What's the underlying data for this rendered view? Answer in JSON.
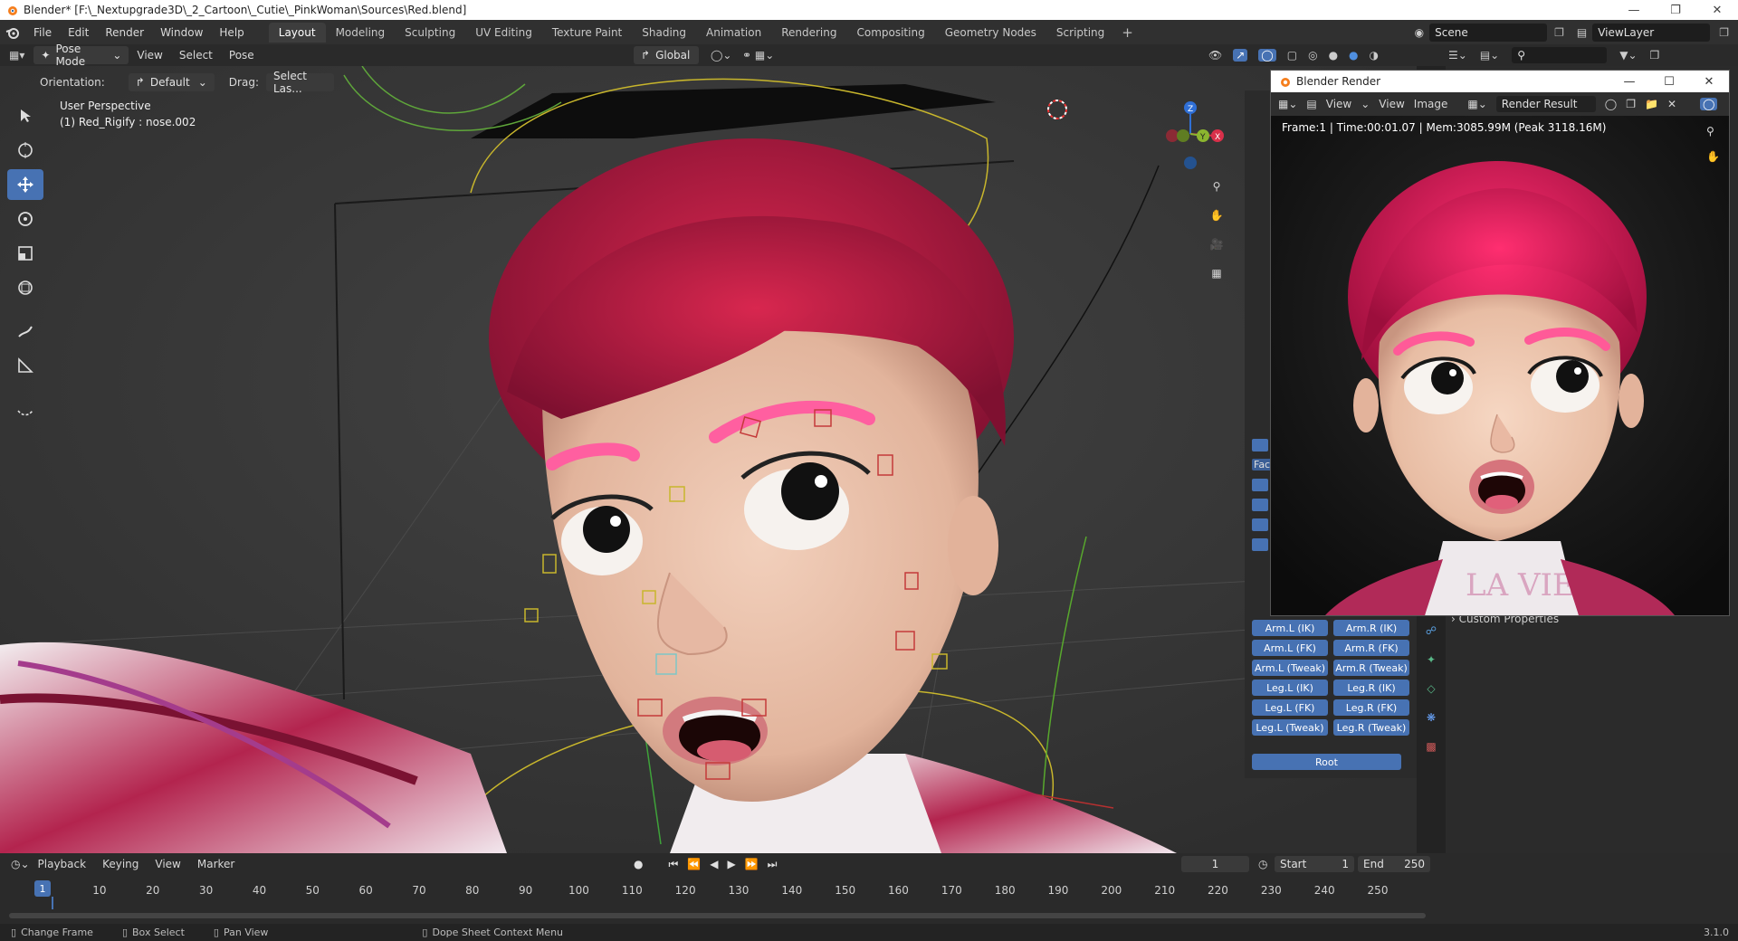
{
  "window": {
    "title": "Blender* [F:\\_Nextupgrade3D\\_2_Cartoon\\_Cutie\\_PinkWoman\\Sources\\Red.blend]"
  },
  "menu": {
    "items": [
      "File",
      "Edit",
      "Render",
      "Window",
      "Help"
    ],
    "workspaces": [
      "Layout",
      "Modeling",
      "Sculpting",
      "UV Editing",
      "Texture Paint",
      "Shading",
      "Animation",
      "Rendering",
      "Compositing",
      "Geometry Nodes",
      "Scripting"
    ],
    "active_workspace": "Layout",
    "scene": "Scene",
    "view_layer": "ViewLayer"
  },
  "viewport_header": {
    "mode": "Pose Mode",
    "menus": [
      "View",
      "Select",
      "Pose"
    ],
    "transform_orientation": "Global"
  },
  "tool_options": {
    "orientation_label": "Orientation:",
    "orientation_value": "Default",
    "drag_label": "Drag:",
    "drag_value": "Select Las..."
  },
  "viewport": {
    "perspective": "User Perspective",
    "active_object": "(1) Red_Rigify : nose.002",
    "accent": "#4772b3"
  },
  "rig_ui": {
    "buttons": [
      [
        "Arm.L (IK)",
        "Arm.R (IK)"
      ],
      [
        "Arm.L (FK)",
        "Arm.R (FK)"
      ],
      [
        "Arm.L (Tweak)",
        "Arm.R (Tweak)"
      ],
      [
        "Leg.L (IK)",
        "Leg.R (IK)"
      ],
      [
        "Leg.L (FK)",
        "Leg.R (FK)"
      ],
      [
        "Leg.L (Tweak)",
        "Leg.R (Tweak)"
      ]
    ],
    "root": "Root",
    "face_label": "Fac"
  },
  "properties": {
    "custom_properties": "Custom Properties"
  },
  "render_window": {
    "title": "Blender Render",
    "menus": [
      "View",
      "View",
      "Image"
    ],
    "image_name": "Render Result",
    "frame_info": "Frame:1 | Time:00:01.07 | Mem:3085.99M (Peak 3118.16M)"
  },
  "timeline": {
    "menus": [
      "Playback",
      "Keying",
      "View",
      "Marker"
    ],
    "current_frame": "1",
    "start_label": "Start",
    "start": "1",
    "end_label": "End",
    "end": "250",
    "ticks": [
      "1",
      "10",
      "20",
      "30",
      "40",
      "50",
      "60",
      "70",
      "80",
      "90",
      "100",
      "110",
      "120",
      "130",
      "140",
      "150",
      "160",
      "170",
      "180",
      "190",
      "200",
      "210",
      "220",
      "230",
      "240",
      "250"
    ]
  },
  "status": {
    "change_frame": "Change Frame",
    "box_select": "Box Select",
    "pan_view": "Pan View",
    "context_menu": "Dope Sheet Context Menu",
    "version": "3.1.0"
  }
}
